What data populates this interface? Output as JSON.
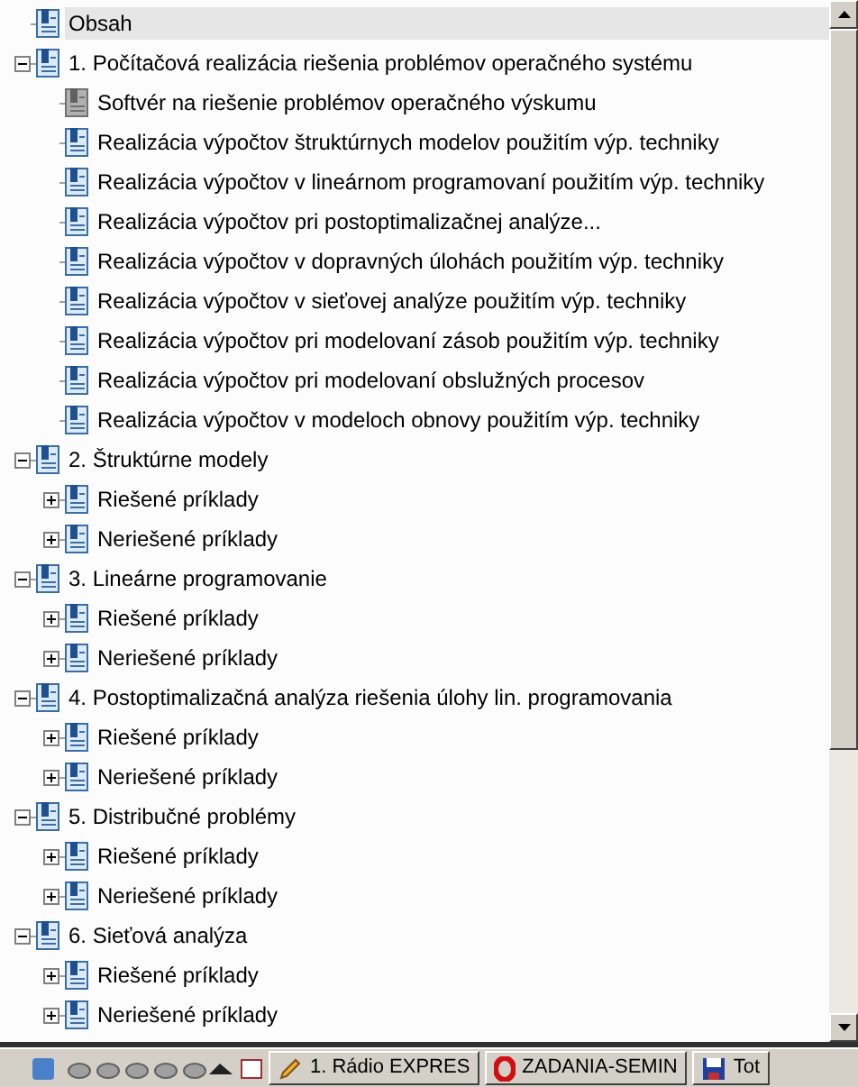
{
  "tree": [
    {
      "title": "Obsah",
      "kind": "page",
      "selected": true
    },
    {
      "title": "1. Počítačová realizácia riešenia problémov operačného systému",
      "kind": "page",
      "selected": false,
      "expanded": true,
      "children": [
        {
          "title": "Softvér na riešenie problémov operačného výskumu",
          "kind": "gray",
          "selected": false
        },
        {
          "title": "Realizácia výpočtov štruktúrnych modelov použitím výp. techniky",
          "kind": "page",
          "selected": false
        },
        {
          "title": "Realizácia výpočtov v lineárnom programovaní použitím výp. techniky",
          "kind": "page",
          "selected": false
        },
        {
          "title": "Realizácia výpočtov pri postoptimalizačnej analýze...",
          "kind": "page",
          "selected": false
        },
        {
          "title": "Realizácia výpočtov v dopravných úlohách použitím výp. techniky",
          "kind": "page",
          "selected": false
        },
        {
          "title": "Realizácia výpočtov v sieťovej analýze použitím výp. techniky",
          "kind": "page",
          "selected": false
        },
        {
          "title": "Realizácia výpočtov pri modelovaní zásob použitím výp. techniky",
          "kind": "page",
          "selected": false
        },
        {
          "title": "Realizácia výpočtov pri modelovaní obslužných procesov",
          "kind": "page",
          "selected": false
        },
        {
          "title": "Realizácia výpočtov v modeloch obnovy použitím výp. techniky",
          "kind": "page",
          "selected": false
        }
      ]
    },
    {
      "title": "2. Štruktúrne modely",
      "kind": "page",
      "selected": false,
      "expanded": true,
      "children": [
        {
          "title": "Riešené príklady",
          "kind": "page",
          "selected": false,
          "expanded": false
        },
        {
          "title": "Neriešené príklady",
          "kind": "page",
          "selected": false,
          "expanded": false
        }
      ]
    },
    {
      "title": "3. Lineárne programovanie",
      "kind": "page",
      "selected": false,
      "expanded": true,
      "children": [
        {
          "title": "Riešené príklady",
          "kind": "page",
          "selected": false,
          "expanded": false
        },
        {
          "title": "Neriešené príklady",
          "kind": "page",
          "selected": false,
          "expanded": false
        }
      ]
    },
    {
      "title": "4. Postoptimalizačná analýza riešenia úlohy lin. programovania",
      "kind": "page",
      "selected": false,
      "expanded": true,
      "children": [
        {
          "title": "Riešené príklady",
          "kind": "page",
          "selected": false,
          "expanded": false
        },
        {
          "title": "Neriešené príklady",
          "kind": "page",
          "selected": false,
          "expanded": false
        }
      ]
    },
    {
      "title": "5. Distribučné problémy",
      "kind": "page",
      "selected": false,
      "expanded": true,
      "children": [
        {
          "title": "Riešené príklady",
          "kind": "page",
          "selected": false,
          "expanded": false
        },
        {
          "title": "Neriešené príklady",
          "kind": "page",
          "selected": false,
          "expanded": false
        }
      ]
    },
    {
      "title": "6. Sieťová analýza",
      "kind": "page",
      "selected": false,
      "expanded": true,
      "children": [
        {
          "title": "Riešené príklady",
          "kind": "page",
          "selected": false,
          "expanded": false
        },
        {
          "title": "Neriešené príklady",
          "kind": "page",
          "selected": false,
          "expanded": false
        }
      ]
    }
  ],
  "taskbar": {
    "buttons": [
      {
        "label": "1. Rádio EXPRES",
        "kind": "pencil"
      },
      {
        "label": "ZADANIA-SEMIN",
        "kind": "opera"
      },
      {
        "label": "Tot",
        "kind": "disk"
      }
    ]
  }
}
